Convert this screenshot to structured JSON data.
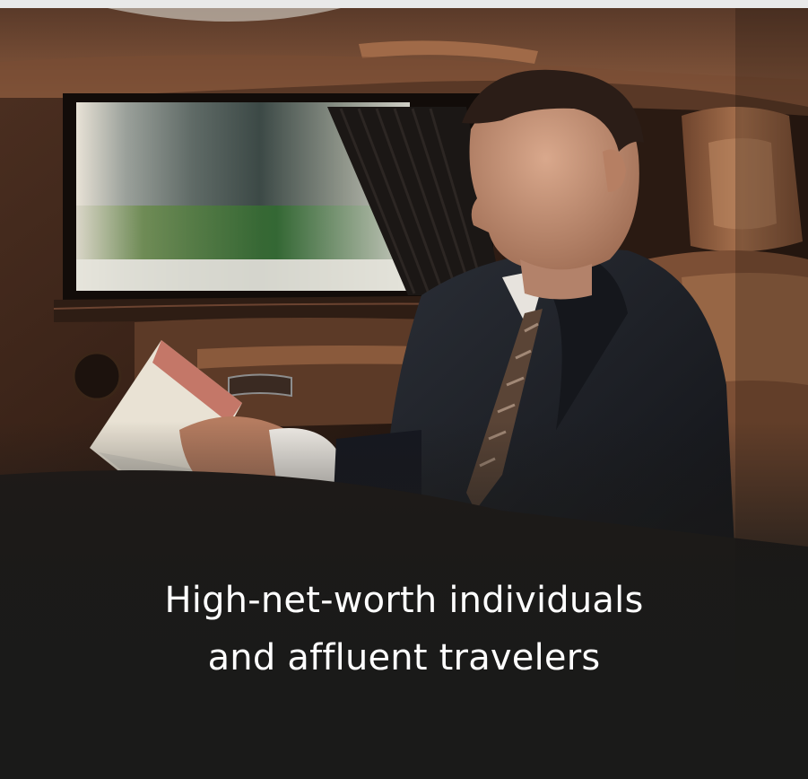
{
  "hero": {
    "caption_line1": "High-net-worth individuals",
    "caption_line2": "and affluent travelers"
  },
  "colors": {
    "background": "#1a1a19",
    "caption_text": "#ffffff",
    "interior_leather": "#8a5a3c",
    "suit": "#1c1f26"
  }
}
